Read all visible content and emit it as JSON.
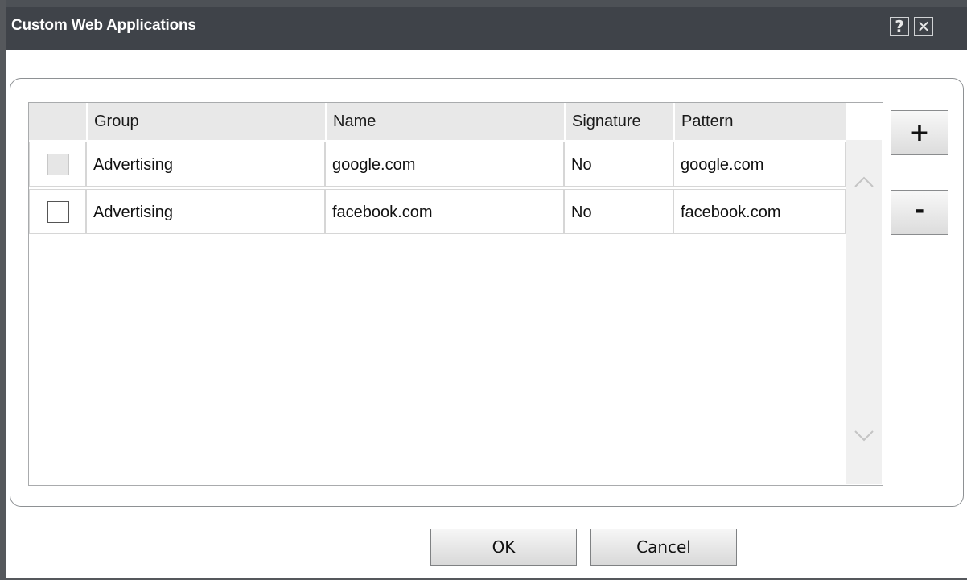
{
  "window": {
    "title": "Custom Web Applications",
    "help_glyph": "?",
    "close_glyph": "✕"
  },
  "table": {
    "columns": [
      "Group",
      "Name",
      "Signature",
      "Pattern"
    ],
    "rows": [
      {
        "checked": false,
        "disabled": true,
        "group": "Advertising",
        "name": "google.com",
        "signature": "No",
        "pattern": "google.com"
      },
      {
        "checked": false,
        "disabled": false,
        "group": "Advertising",
        "name": "facebook.com",
        "signature": "No",
        "pattern": "facebook.com"
      }
    ]
  },
  "actions": {
    "add_label": "+",
    "remove_label": "-",
    "ok_label": "OK",
    "cancel_label": "Cancel"
  },
  "colors": {
    "titlebar": "#3f4349",
    "window_border": "#55585c",
    "header_bg": "#e8e8e8",
    "scrollbar_bg": "#f0f0f0"
  },
  "icons": {
    "scroll_up": "chevron-up-icon",
    "scroll_down": "chevron-down-icon"
  }
}
